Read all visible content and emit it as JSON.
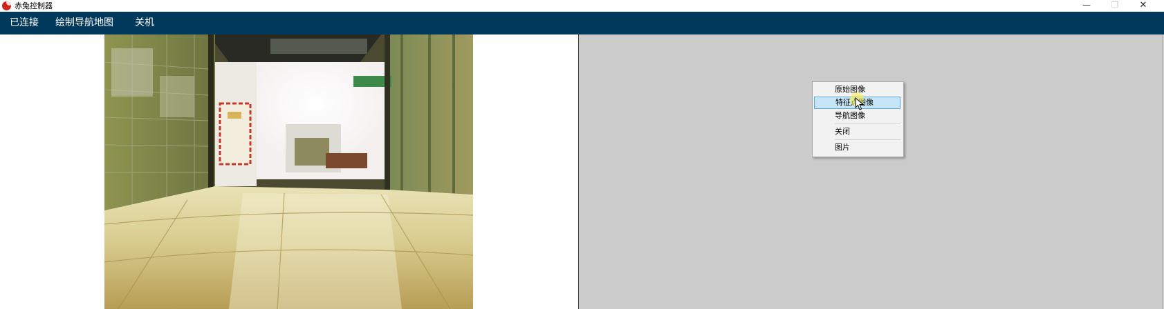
{
  "window": {
    "title": "赤兔控制器",
    "controls": {
      "minimize": "—",
      "maximize": "❐",
      "close": "✕"
    }
  },
  "menubar": {
    "items": [
      {
        "label": "已连接"
      },
      {
        "label": "绘制导航地图"
      },
      {
        "label": "关机"
      }
    ]
  },
  "context_menu": {
    "items": [
      {
        "label": "原始图像",
        "highlighted": false
      },
      {
        "label": "特征点图像",
        "highlighted": true
      },
      {
        "label": "导航图像",
        "highlighted": false
      },
      {
        "label": "关闭",
        "highlighted": false
      },
      {
        "label": "图片",
        "highlighted": false
      }
    ]
  },
  "colors": {
    "menubar_bg": "#00395c",
    "right_pane_bg": "#cbcbcb",
    "menu_highlight": "#c5e4f5",
    "app_icon": "#d0241b"
  },
  "icons": [
    "app-logo-icon",
    "minimize-icon",
    "maximize-icon",
    "close-icon",
    "mouse-pointer-icon"
  ]
}
